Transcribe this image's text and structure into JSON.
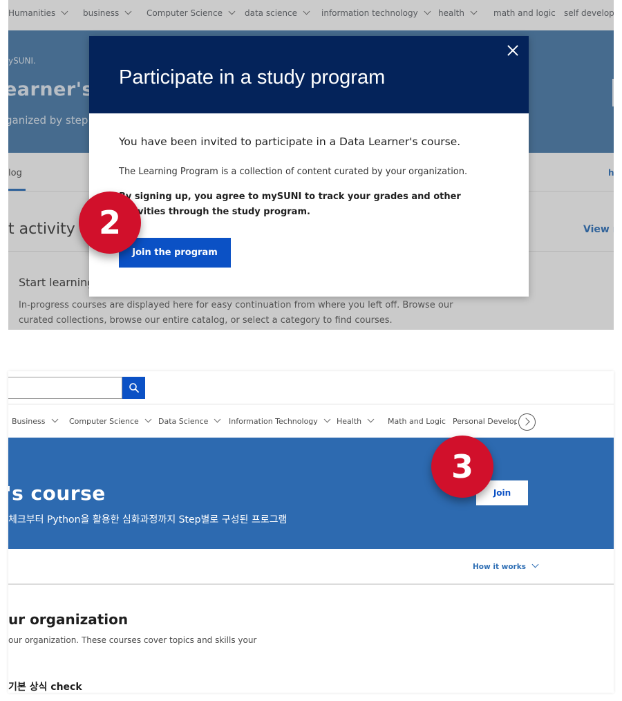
{
  "panel1": {
    "nav": {
      "items": [
        {
          "label": "Humanities"
        },
        {
          "label": "business"
        },
        {
          "label": "Computer Science"
        },
        {
          "label": "data science"
        },
        {
          "label": "information technology"
        },
        {
          "label": "health"
        },
        {
          "label": "math and logic"
        },
        {
          "label": "self developer"
        }
      ]
    },
    "hero": {
      "kicker": "ySUNI.",
      "title": "earner's",
      "subtitle": "ganized by step"
    },
    "tabs": {
      "catalog": "log",
      "right_link": "h"
    },
    "recent": {
      "title": "t activity",
      "view_more": "View m"
    },
    "start": {
      "heading": "Start learning",
      "body": "In-progress courses are displayed here for easy continuation from where you left off. Browse our curated collections, browse our entire catalog, or select a category to find courses."
    },
    "modal": {
      "title": "Participate in a study program",
      "invite": "You have been invited to participate in a Data Learner's course.",
      "description": "The Learning Program is a collection of content curated by your organization.",
      "consent": "By signing up, you agree to mySUNI to track your grades and other activities through the study program.",
      "join_label": "Join the program",
      "close_icon": "close-icon"
    },
    "step_badge": "2"
  },
  "panel2": {
    "search": {
      "value": "",
      "icon": "search-icon"
    },
    "nav": {
      "items": [
        {
          "label": "Business"
        },
        {
          "label": "Computer Science"
        },
        {
          "label": "Data Science"
        },
        {
          "label": "Information Technology"
        },
        {
          "label": "Health"
        },
        {
          "label": "Math and Logic"
        },
        {
          "label": "Personal Developm"
        }
      ],
      "next_icon": "chevron-right-circle-icon"
    },
    "hero": {
      "title": "'s  course",
      "subtitle": "체크부터 Python을 활용한 심화과정까지 Step별로 구성된 프로그램",
      "join_label": "Join"
    },
    "how_it_works": "How it works",
    "org": {
      "title": "ur organization",
      "description": "our organization. These courses cover topics and skills your"
    },
    "course_heading": "기본 상식 check",
    "step_badge": "3"
  },
  "colors": {
    "modal_header": "#04235a",
    "primary_button": "#0b51c5",
    "hero_blue": "#2d6ab0",
    "badge_red": "#d1102b"
  }
}
